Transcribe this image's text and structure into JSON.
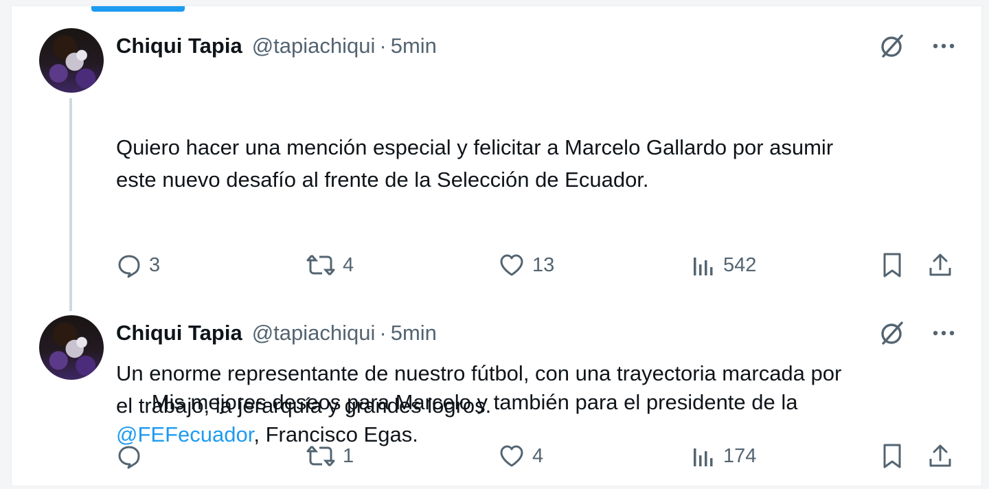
{
  "tweets": [
    {
      "author_name": "Chiqui Tapia",
      "author_handle": "@tapiachiqui",
      "separator": "·",
      "time": "5min",
      "text_p1": "Quiero hacer una mención especial y felicitar a Marcelo Gallardo por asumir\neste nuevo desafío al frente de la Selección de Ecuador.",
      "text_p2": "Un enorme representante de nuestro fútbol, con una trayectoria marcada por\nel trabajo, la jerarquía y grandes logros.",
      "replies": "3",
      "retweets": "4",
      "likes": "13",
      "views": "542"
    },
    {
      "author_name": "Chiqui Tapia",
      "author_handle": "@tapiachiqui",
      "separator": "·",
      "time": "5min",
      "text_before": "Mis mejores deseos para Marcelo y también para el presidente de la\n",
      "mention": "@FEFecuador",
      "text_after": ", Francisco Egas.",
      "replies": "",
      "retweets": "1",
      "likes": "4",
      "views": "174"
    }
  ],
  "icons": {
    "grok": "grok-icon",
    "more": "more-icon",
    "reply": "reply-icon",
    "retweet": "retweet-icon",
    "like": "heart-icon",
    "views": "views-icon",
    "bookmark": "bookmark-icon",
    "share": "share-icon"
  },
  "colors": {
    "accent": "#1d9bf0",
    "text": "#0f1419",
    "secondary": "#536471",
    "thread_line": "#cfd9de"
  }
}
